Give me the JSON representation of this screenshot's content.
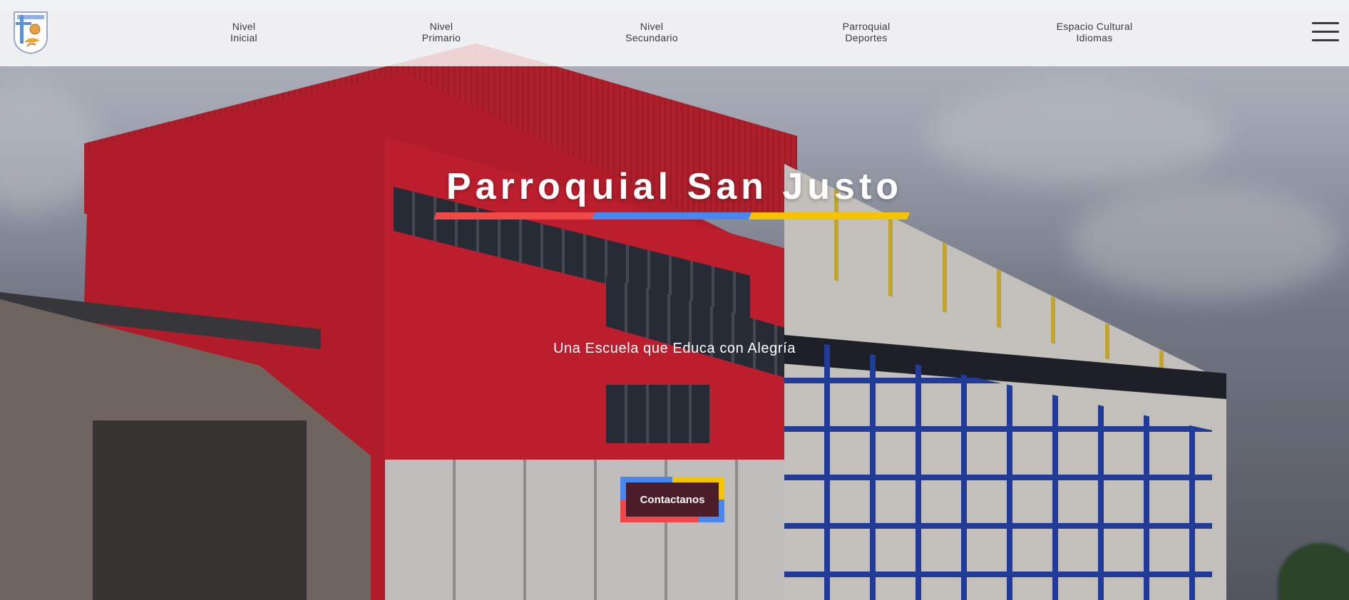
{
  "site": {
    "logo_icon": "school-crest-icon"
  },
  "nav": {
    "items": [
      {
        "line1": "Nivel",
        "line2": "Inicial"
      },
      {
        "line1": "Nivel",
        "line2": "Primario"
      },
      {
        "line1": "Nivel",
        "line2": "Secundario"
      },
      {
        "line1": "Parroquial",
        "line2": "Deportes"
      },
      {
        "line1": "Espacio Cultural",
        "line2": "Idiomas"
      }
    ],
    "menu_icon": "hamburger-menu-icon"
  },
  "hero": {
    "title": "Parroquial San Justo",
    "subtitle": "Una Escuela que Educa con Alegría",
    "cta_label": "Contactanos"
  },
  "colors": {
    "red": "#f04747",
    "blue": "#4a86f0",
    "yellow": "#f5c400",
    "cta_fill": "#4b1c2a",
    "header_bg": "rgba(255,255,255,0.80)",
    "nav_text": "#3a3a3a"
  }
}
